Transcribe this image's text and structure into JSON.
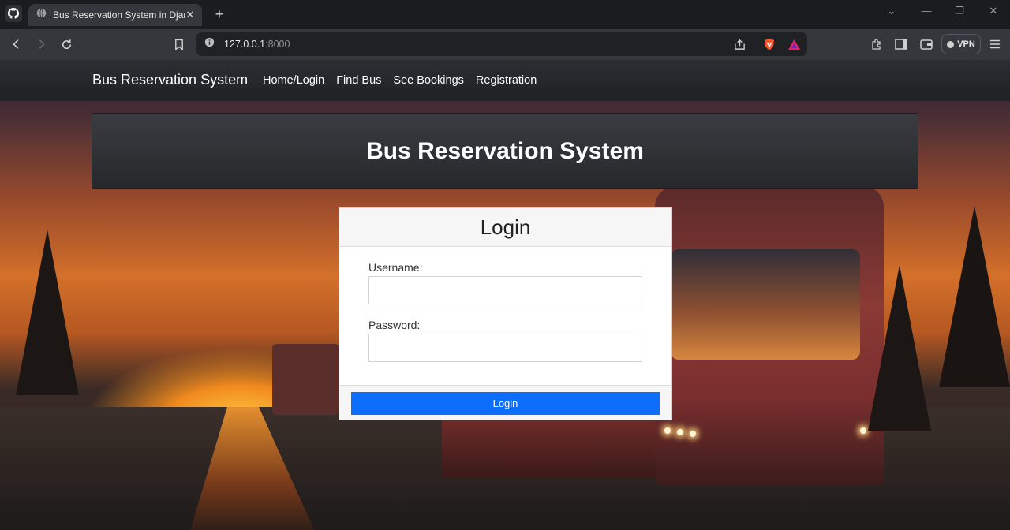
{
  "browser": {
    "tab_title": "Bus Reservation System in Djang",
    "url_host": "127.0.0.1",
    "url_port": ":8000",
    "vpn_label": "VPN",
    "icons": {
      "github": "github-icon",
      "tab_favicon": "globe-icon",
      "tab_close": "close-icon",
      "new_tab": "plus-icon",
      "back": "back-arrow-icon",
      "forward": "forward-arrow-icon",
      "reload": "reload-icon",
      "bookmark": "bookmark-icon",
      "site_info": "info-icon",
      "share": "share-icon",
      "brave": "brave-shield-icon",
      "rewards": "rewards-triangle-icon",
      "extensions": "puzzle-icon",
      "sidebar": "sidebar-icon",
      "wallet": "wallet-icon",
      "menu": "hamburger-menu-icon"
    },
    "window_controls": {
      "dropdown": "⌄",
      "minimize": "—",
      "restore": "❐",
      "close": "✕"
    }
  },
  "navbar": {
    "brand": "Bus Reservation System",
    "links": [
      "Home/Login",
      "Find Bus",
      "See Bookings",
      "Registration"
    ]
  },
  "hero": {
    "title": "Bus Reservation System"
  },
  "login_form": {
    "title": "Login",
    "username_label": "Username:",
    "username_value": "",
    "password_label": "Password:",
    "password_value": "",
    "submit_label": "Login"
  },
  "colors": {
    "primary_button": "#0d6efd",
    "navbar_bg": "#25272b",
    "hero_bg": "#2f3135"
  }
}
